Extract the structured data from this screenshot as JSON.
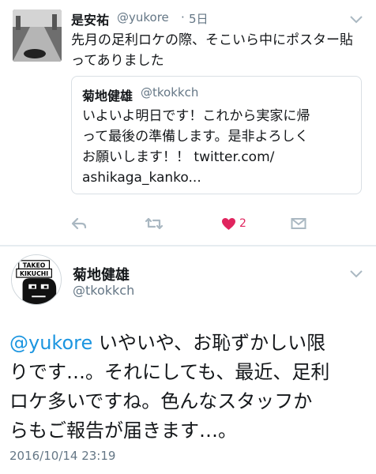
{
  "reply_tweet": {
    "display_name": "是安祐",
    "handle": "@yukore",
    "separator": "·",
    "time": "5日",
    "body": "先月の足利ロケの際、そこいら中にポスター貼ってありました",
    "quoted": {
      "display_name": "菊地健雄",
      "handle": "@tkokkch",
      "lines": [
        "いよいよ明日です！これから実家に帰",
        "って最後の準備します。是非よろしく",
        "お願いします！！ twitter.com/",
        "ashikaga_kanko..."
      ]
    },
    "actions": {
      "reply_icon": "reply-arrow",
      "retweet_icon": "retweet-arrows",
      "like_icon": "heart-filled",
      "like_count": "2",
      "dm_icon": "envelope"
    }
  },
  "main_tweet": {
    "display_name": "菊地健雄",
    "handle": "@tkokkch",
    "avatar_text": [
      "TAKEO",
      "KIKUCHI"
    ],
    "mention": "@yukore",
    "lines": [
      " いやいや、お恥ずかしい限",
      "りです…。それにしても、最近、足利",
      "ロケ多いですね。色んなスタッフか",
      "らもご報告が届きます…。"
    ],
    "date": "2016/10/14 23:19"
  },
  "colors": {
    "link": "#1b95e0",
    "secondary_text": "#657786",
    "like": "#e0245e",
    "divider": "#e6ecf0"
  }
}
